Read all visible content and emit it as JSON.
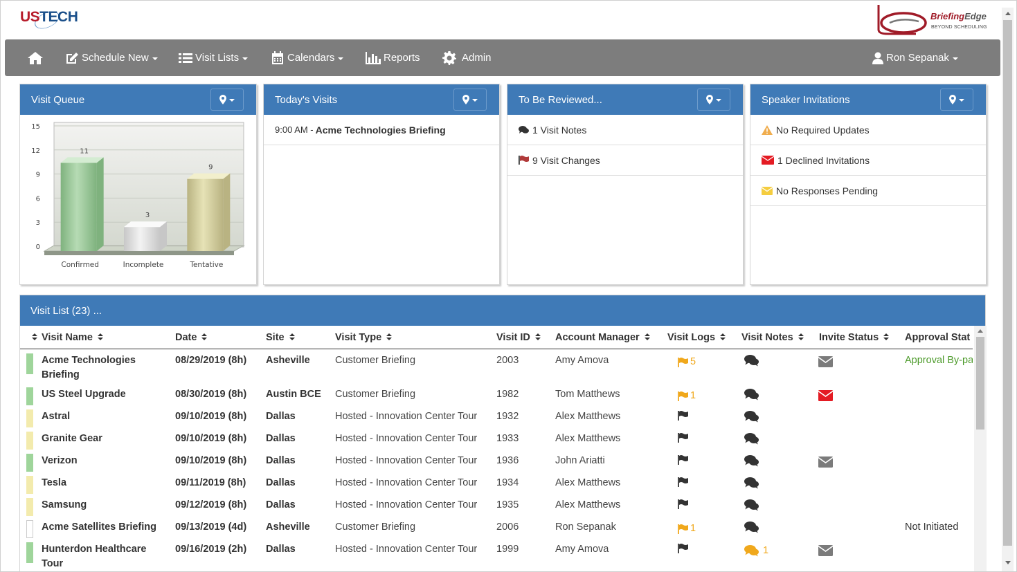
{
  "header": {
    "logo_us": "US",
    "logo_tech": "TECH",
    "brand_title_a": "Briefing",
    "brand_title_b": "Edge",
    "brand_sub": "BEYOND SCHEDULING"
  },
  "nav": {
    "home_icon": "home-icon",
    "schedule_new": "Schedule New",
    "visit_lists": "Visit Lists",
    "calendars": "Calendars",
    "reports": "Reports",
    "admin": "Admin",
    "user": "Ron Sepanak"
  },
  "colors": {
    "nav_bg": "#7d7d7d",
    "panel_header": "#3f7ab7",
    "confirmed": "#9fd59b",
    "tentative": "#f3ebad",
    "warning": "#f0ad4e",
    "danger": "#e41b23",
    "approval_green": "#4c9a2a"
  },
  "panels": {
    "visit_queue": {
      "title": "Visit Queue"
    },
    "todays_visits": {
      "title": "Today's Visits",
      "items": [
        {
          "time": "9:00 AM - ",
          "name": "Acme Technologies Briefing"
        }
      ]
    },
    "to_be_reviewed": {
      "title": "To Be Reviewed...",
      "items": [
        {
          "icon": "comments-icon",
          "text": "1 Visit Notes"
        },
        {
          "icon": "flag-icon",
          "text": "9 Visit Changes"
        }
      ]
    },
    "speaker_invitations": {
      "title": "Speaker Invitations",
      "items": [
        {
          "icon": "warning-icon",
          "text": "No Required Updates"
        },
        {
          "icon": "envelope-icon",
          "text": "1 Declined Invitations"
        },
        {
          "icon": "envelope-icon",
          "text": "No Responses Pending"
        }
      ]
    }
  },
  "chart_data": {
    "type": "bar",
    "categories": [
      "Confirmed",
      "Incomplete",
      "Tentative"
    ],
    "values": [
      11,
      3,
      9
    ],
    "ylim": [
      0,
      15
    ],
    "yticks": [
      0,
      3,
      6,
      9,
      12,
      15
    ],
    "bar_colors": [
      "#a9d2a8",
      "#e8e8e8",
      "#dcd8a8"
    ],
    "grid": true,
    "title": "",
    "xlabel": "",
    "ylabel": ""
  },
  "visit_list": {
    "title": "Visit List (23) ...",
    "columns": [
      "Visit Name",
      "Date",
      "Site",
      "Visit Type",
      "Visit ID",
      "Account Manager",
      "Visit Logs",
      "Visit Notes",
      "Invite Status",
      "Approval Stat"
    ],
    "rows": [
      {
        "status": "confirmed",
        "name": [
          "Acme Technologies",
          "Briefing"
        ],
        "date": "08/29/2019 (8h)",
        "site": "Asheville",
        "type": "Customer Briefing",
        "id": "2003",
        "manager": "Amy Amova",
        "logs": {
          "flag": "orange",
          "count": "5"
        },
        "notes": {
          "color": "dark",
          "count": ""
        },
        "invite": "gray",
        "approval": "Approval By-pa"
      },
      {
        "status": "confirmed",
        "name": [
          "US Steel Upgrade"
        ],
        "date": "08/30/2019 (8h)",
        "site": "Austin BCE",
        "type": "Customer Briefing",
        "id": "1982",
        "manager": "Tom Matthews",
        "logs": {
          "flag": "orange",
          "count": "1"
        },
        "notes": {
          "color": "dark",
          "count": ""
        },
        "invite": "red",
        "approval": ""
      },
      {
        "status": "tentative",
        "name": [
          "Astral"
        ],
        "date": "09/10/2019 (8h)",
        "site": "Dallas",
        "type": "Hosted - Innovation Center Tour",
        "id": "1932",
        "manager": "Alex Matthews",
        "logs": {
          "flag": "dark",
          "count": ""
        },
        "notes": {
          "color": "dark",
          "count": ""
        },
        "invite": "",
        "approval": ""
      },
      {
        "status": "tentative",
        "name": [
          "Granite Gear"
        ],
        "date": "09/10/2019 (8h)",
        "site": "Dallas",
        "type": "Hosted - Innovation Center Tour",
        "id": "1933",
        "manager": "Alex Matthews",
        "logs": {
          "flag": "dark",
          "count": ""
        },
        "notes": {
          "color": "dark",
          "count": ""
        },
        "invite": "",
        "approval": ""
      },
      {
        "status": "confirmed",
        "name": [
          "Verizon"
        ],
        "date": "09/10/2019 (8h)",
        "site": "Dallas",
        "type": "Hosted - Innovation Center Tour",
        "id": "1936",
        "manager": "John Ariatti",
        "logs": {
          "flag": "dark",
          "count": ""
        },
        "notes": {
          "color": "dark",
          "count": ""
        },
        "invite": "gray",
        "approval": ""
      },
      {
        "status": "tentative",
        "name": [
          "Tesla"
        ],
        "date": "09/11/2019 (8h)",
        "site": "Dallas",
        "type": "Hosted - Innovation Center Tour",
        "id": "1934",
        "manager": "Alex Matthews",
        "logs": {
          "flag": "dark",
          "count": ""
        },
        "notes": {
          "color": "dark",
          "count": ""
        },
        "invite": "",
        "approval": ""
      },
      {
        "status": "tentative",
        "name": [
          "Samsung"
        ],
        "date": "09/12/2019 (8h)",
        "site": "Dallas",
        "type": "Hosted - Innovation Center Tour",
        "id": "1935",
        "manager": "Alex Matthews",
        "logs": {
          "flag": "dark",
          "count": ""
        },
        "notes": {
          "color": "dark",
          "count": ""
        },
        "invite": "",
        "approval": ""
      },
      {
        "status": "incomplete",
        "name": [
          "Acme Satellites Briefing"
        ],
        "date": "09/13/2019 (4d)",
        "site": "Asheville",
        "type": "Customer Briefing",
        "id": "2006",
        "manager": "Ron Sepanak",
        "logs": {
          "flag": "orange",
          "count": "1"
        },
        "notes": {
          "color": "dark",
          "count": ""
        },
        "invite": "",
        "approval": "Not Initiated"
      },
      {
        "status": "confirmed",
        "name": [
          "Hunterdon Healthcare",
          "Tour"
        ],
        "date": "09/16/2019 (2h)",
        "site": "Dallas",
        "type": "Hosted - Innovation Center Tour",
        "id": "1999",
        "manager": "Amy Amova",
        "logs": {
          "flag": "dark",
          "count": ""
        },
        "notes": {
          "color": "orange",
          "count": "1"
        },
        "invite": "gray",
        "approval": ""
      }
    ]
  }
}
